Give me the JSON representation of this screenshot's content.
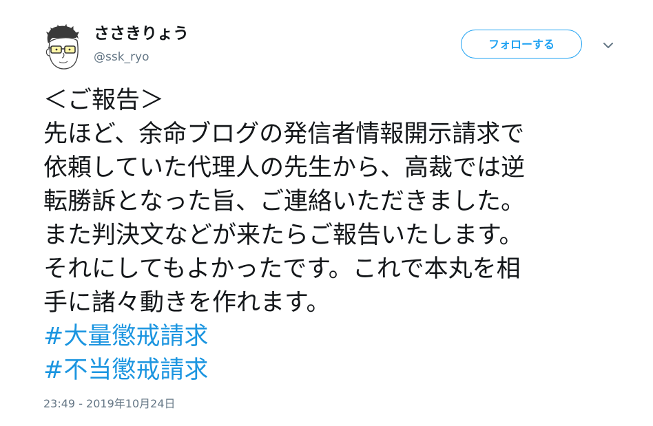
{
  "user": {
    "display_name": "ささきりょう",
    "handle": "@ssk_ryo"
  },
  "actions": {
    "follow_label": "フォローする",
    "caret_icon": "chevron-down-icon"
  },
  "tweet": {
    "lines": [
      "＜ご報告＞",
      "先ほど、余命ブログの発信者情報開示請求で",
      "依頼していた代理人の先生から、高裁では逆",
      "転勝訴となった旨、ご連絡いただきました。",
      "また判決文などが来たらご報告いたします。",
      "それにしてもよかったです。これで本丸を相",
      "手に諸々動きを作れます。"
    ],
    "hashtags": [
      "#大量懲戒請求",
      "#不当懲戒請求"
    ],
    "timestamp": "23:49 - 2019年10月24日"
  },
  "colors": {
    "text": "#14171a",
    "secondary": "#657786",
    "accent": "#1da1f2",
    "link": "#1b95e0"
  }
}
